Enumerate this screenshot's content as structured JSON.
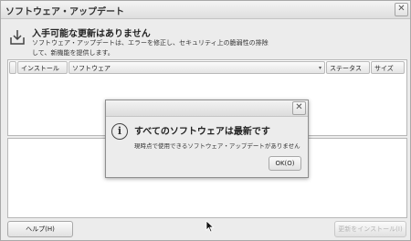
{
  "window": {
    "title": "ソフトウェア・アップデート",
    "close": "✕"
  },
  "header": {
    "icon": "download-icon",
    "title": "入手可能な更新はありません",
    "desc": "ソフトウェア・アップデートは、エラーを修正し、セキュリティ上の脆弱性の排除して、新機能を提供します。"
  },
  "list": {
    "columns": [
      "インストール",
      "ソフトウェア",
      "ステータス",
      "サイズ"
    ],
    "sort_indicator": "▾"
  },
  "buttons": {
    "help": "ヘルプ(H)",
    "install": "更新をインストール(I)"
  },
  "dialog": {
    "close": "✕",
    "icon": "info-icon",
    "icon_glyph": "i",
    "title": "すべてのソフトウェアは最新です",
    "message": "現時点で使用できるソフトウェア・アップデートがありません",
    "ok": "OK(O)"
  }
}
